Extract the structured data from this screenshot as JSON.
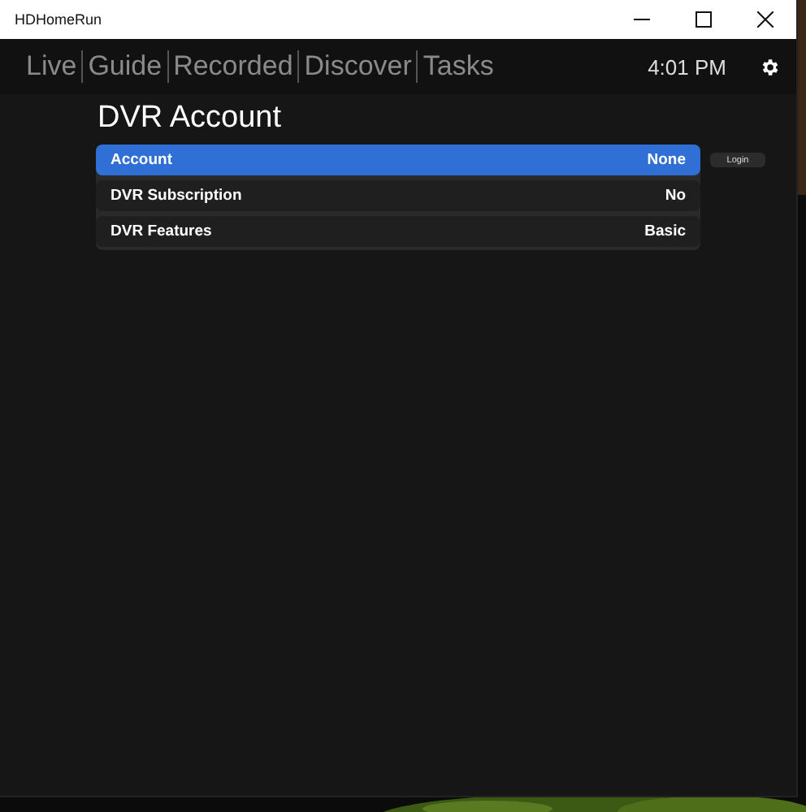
{
  "window": {
    "title": "HDHomeRun"
  },
  "nav": {
    "tabs": [
      {
        "label": "Live"
      },
      {
        "label": "Guide"
      },
      {
        "label": "Recorded"
      },
      {
        "label": "Discover"
      },
      {
        "label": "Tasks"
      }
    ],
    "clock": "4:01 PM"
  },
  "heading": "DVR Account",
  "rows": [
    {
      "label": "Account",
      "value": "None",
      "selected": true
    },
    {
      "label": "DVR Subscription",
      "value": "No",
      "selected": false
    },
    {
      "label": "DVR Features",
      "value": "Basic",
      "selected": false
    }
  ],
  "login_button": "Login"
}
